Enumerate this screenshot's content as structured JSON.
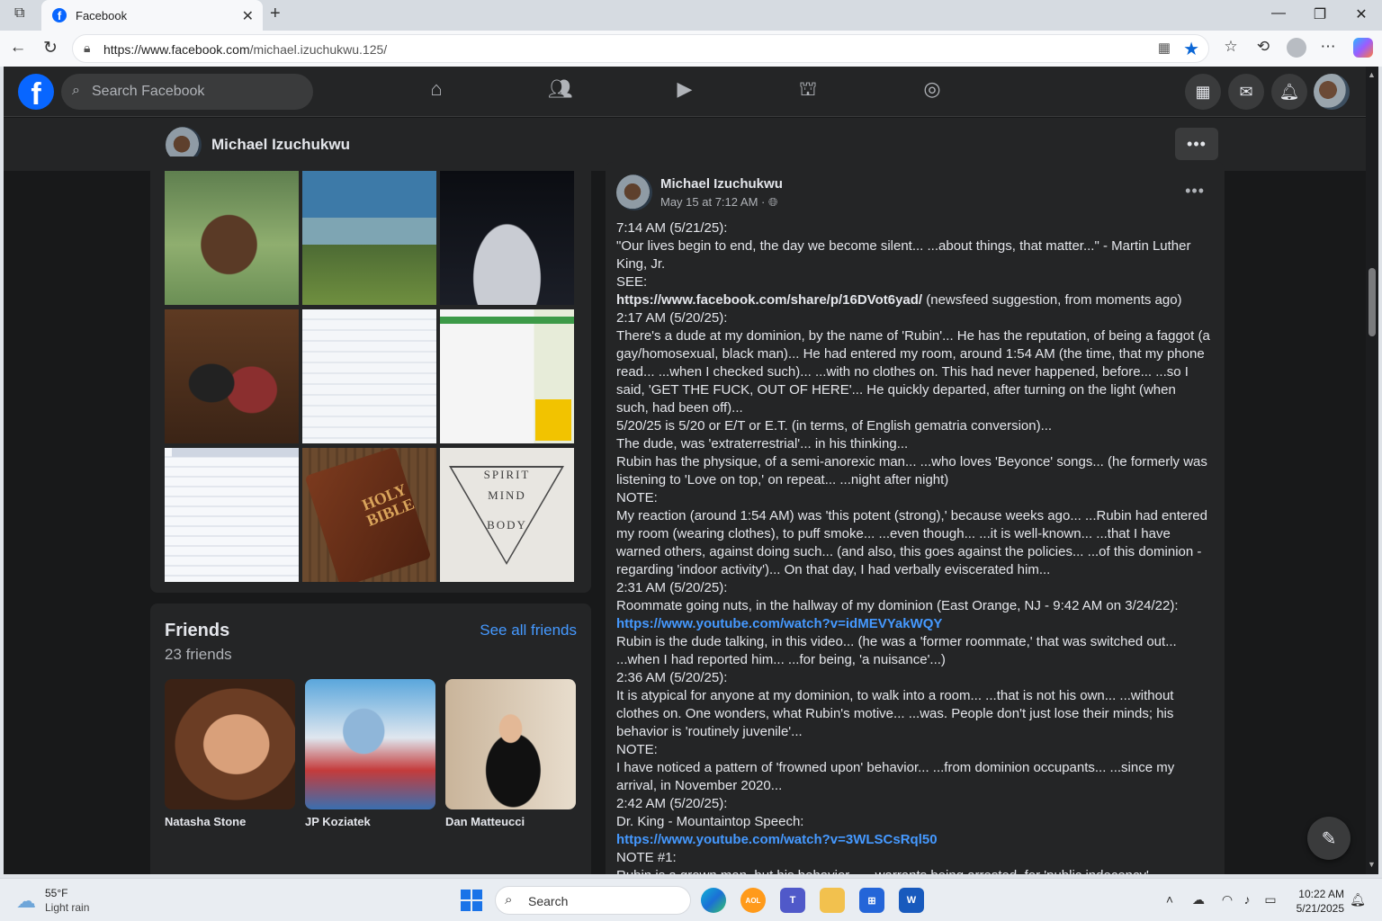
{
  "browser": {
    "tab_title": "Facebook",
    "url_host": "https://www.facebook.com",
    "url_path": "/michael.izuchukwu.125/"
  },
  "fb": {
    "search_placeholder": "Search Facebook"
  },
  "profile": {
    "name": "Michael Izuchukwu"
  },
  "photos": {
    "bible_text": "HOLY BIBLE",
    "triangle_words": [
      "SPIRIT",
      "MIND",
      "BODY"
    ]
  },
  "friends": {
    "title": "Friends",
    "count": "23 friends",
    "see_all": "See all friends",
    "items": [
      {
        "name": "Natasha Stone"
      },
      {
        "name": "JP Koziatek"
      },
      {
        "name": "Dan Matteucci"
      }
    ]
  },
  "post": {
    "author": "Michael Izuchukwu",
    "date": "May 15 at 7:12 AM · ",
    "lines": [
      {
        "text": "7:14 AM (5/21/25):"
      },
      {
        "text": "\"Our lives begin to end, the day we become silent... ...about things, that matter...\" - Martin Luther King, Jr."
      },
      {
        "text": "SEE:"
      },
      {
        "link": "https://www.facebook.com/share/p/16DVot6yad/",
        "text": " (newsfeed suggestion, from moments ago)",
        "bold_link": true
      },
      {
        "text": "2:17 AM (5/20/25):"
      },
      {
        "text": "There's a dude at my dominion, by the name of 'Rubin'... He has the reputation, of being a faggot (a gay/homosexual, black man)... He had entered my room, around 1:54 AM (the time, that my phone read... ...when I checked such)... ...with no clothes on. This had never happened, before... ...so I said, 'GET THE FUCK, OUT OF HERE'...  He quickly departed, after turning on the light (when such, had been off)..."
      },
      {
        "text": "5/20/25 is 5/20 or E/T or E.T. (in terms, of English gematria conversion)..."
      },
      {
        "text": "The dude, was 'extraterrestrial'... in his thinking..."
      },
      {
        "text": "Rubin has the physique, of a semi-anorexic man... ...who loves 'Beyonce' songs... (he formerly was listening to 'Love on top,' on repeat... ...night after night)"
      },
      {
        "text": "NOTE:"
      },
      {
        "text": "My reaction (around 1:54 AM) was 'this potent (strong),' because weeks ago... ...Rubin had entered my room (wearing clothes), to puff smoke... ...even though... ...it is well-known... ...that I have warned others, against doing such... (and also, this goes against the policies... ...of this dominion - regarding 'indoor activity')... On that day, I had verbally eviscerated him..."
      },
      {
        "text": "2:31 AM (5/20/25):"
      },
      {
        "text": "Roommate going nuts, in the hallway of my dominion (East Orange, NJ - 9:42 AM on 3/24/22):"
      },
      {
        "link": "https://www.youtube.com/watch?v=idMEVYakWQY",
        "text": ""
      },
      {
        "text": "Rubin is the dude talking, in this video... (he was a 'former roommate,' that was switched out... ...when I had reported him... ...for being, 'a nuisance'...)"
      },
      {
        "text": "2:36 AM (5/20/25):"
      },
      {
        "text": "It is atypical for anyone at my dominion, to walk into a room... ...that is not his own... ...without clothes on. One wonders, what Rubin's motive... ...was. People don't just lose their minds; his behavior is 'routinely juvenile'..."
      },
      {
        "text": "NOTE:"
      },
      {
        "text": "I have noticed a pattern of 'frowned upon' behavior... ...from dominion occupants... ...since my arrival, in November 2020..."
      },
      {
        "text": "2:42 AM (5/20/25):"
      },
      {
        "text": "Dr. King - Mountaintop Speech:"
      },
      {
        "link": "https://www.youtube.com/watch?v=3WLSCsRql50",
        "text": ""
      },
      {
        "text": "NOTE #1:"
      },
      {
        "text": "Rubin is a grown man, but his behavior... ...warrants being arrested, for 'public indecency'..."
      }
    ]
  },
  "taskbar": {
    "temp": "55°F",
    "weather": "Light rain",
    "search_label": "Search",
    "time": "10:22 AM",
    "date": "5/21/2025"
  }
}
